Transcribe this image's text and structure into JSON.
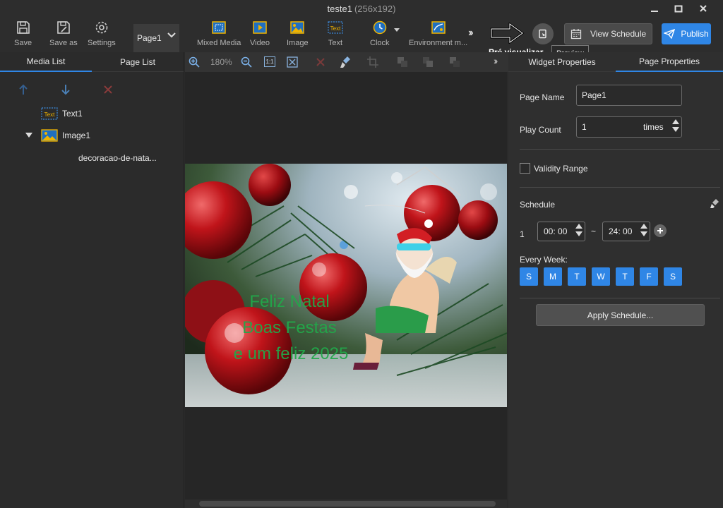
{
  "window": {
    "title": "teste1",
    "resolution": "(256x192)"
  },
  "toolbar": {
    "save": "Save",
    "save_as": "Save as",
    "settings": "Settings",
    "mixed_media": "Mixed Media",
    "video": "Video",
    "image": "Image",
    "text": "Text",
    "clock": "Clock",
    "environment": "Environment m...",
    "view_schedule": "View Schedule",
    "publish": "Publish",
    "preview_tooltip": "Preview",
    "annotation": "Pré visualizar"
  },
  "left_panel": {
    "tabs": [
      "Media List",
      "Page List"
    ],
    "page_select": "Page1",
    "items": {
      "text1": "Text1",
      "image1": "Image1",
      "image_file": "decoracao-de-nata..."
    }
  },
  "canvas": {
    "zoom": "180%",
    "one_to_one": "1:1",
    "overlay_text": [
      "Feliz Natal",
      "Boas Festas",
      "e um feliz 2025"
    ]
  },
  "right_panel": {
    "tabs": [
      "Widget Properties",
      "Page Properties"
    ],
    "page_name_label": "Page Name",
    "page_name": "Page1",
    "play_count_label": "Play Count",
    "play_count": "1",
    "play_count_unit": "times",
    "validity_label": "Validity Range",
    "schedule_label": "Schedule",
    "schedule_index": "1",
    "start_time": "00: 00",
    "tilde": "~",
    "end_time": "24: 00",
    "every_week_label": "Every Week:",
    "days": [
      "S",
      "M",
      "T",
      "W",
      "T",
      "F",
      "S"
    ],
    "apply_schedule": "Apply Schedule..."
  },
  "colors": {
    "accent": "#2f86e6",
    "background": "#2b2b2b",
    "text_green": "#22a84a"
  }
}
